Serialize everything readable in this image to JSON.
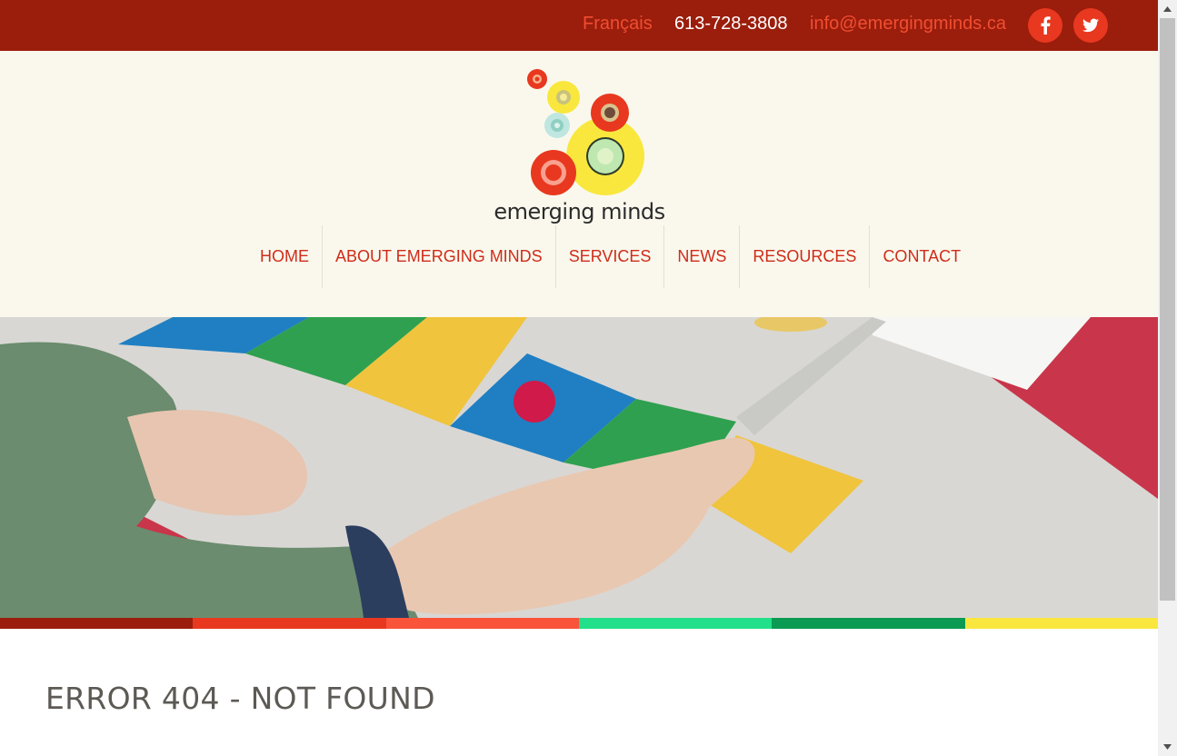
{
  "topbar": {
    "language_link": "Français",
    "phone": "613-728-3808",
    "email": "info@emergingminds.ca",
    "social": [
      {
        "icon": "facebook-icon",
        "label": "f"
      },
      {
        "icon": "twitter-icon",
        "label": ""
      }
    ]
  },
  "header": {
    "logo_text": "emerging minds",
    "nav": [
      {
        "label": "HOME"
      },
      {
        "label": "ABOUT EMERGING MINDS"
      },
      {
        "label": "SERVICES"
      },
      {
        "label": "NEWS"
      },
      {
        "label": "RESOURCES"
      },
      {
        "label": "CONTACT"
      }
    ]
  },
  "hero": {
    "image": "photo of a child's hands playing a colorful board game"
  },
  "stripes": [
    "#9b1d0c",
    "#e8381f",
    "#f9533a",
    "#22e08a",
    "#0b9a52",
    "#f9e73e"
  ],
  "content": {
    "error_title": "ERROR 404 - NOT FOUND"
  },
  "colors": {
    "topbar_bg": "#9b1d0c",
    "accent": "#e8381f",
    "header_bg": "#faf8ed",
    "nav_text": "#cf2c1a"
  }
}
